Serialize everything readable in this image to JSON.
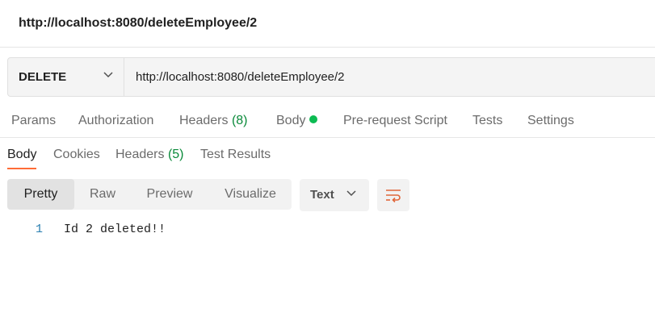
{
  "title": "http://localhost:8080/deleteEmployee/2",
  "request": {
    "method": "DELETE",
    "url": "http://localhost:8080/deleteEmployee/2"
  },
  "request_tabs": {
    "params": "Params",
    "authorization": "Authorization",
    "headers_label": "Headers",
    "headers_count": "(8)",
    "body": "Body",
    "prerequest": "Pre-request Script",
    "tests": "Tests",
    "settings": "Settings"
  },
  "response_tabs": {
    "body": "Body",
    "cookies": "Cookies",
    "headers_label": "Headers",
    "headers_count": "(5)",
    "test_results": "Test Results"
  },
  "view_modes": {
    "pretty": "Pretty",
    "raw": "Raw",
    "preview": "Preview",
    "visualize": "Visualize"
  },
  "format": {
    "selected": "Text"
  },
  "icons": {
    "method_dropdown": "chevron-down-icon",
    "body_status": "green-dot-icon",
    "format_dropdown": "chevron-down-icon",
    "wrap": "text-wrap-icon"
  },
  "colors": {
    "accent": "#ff6c37",
    "status_green": "#0cbb52",
    "count_green": "#0a8a3a",
    "line_number": "#2a7fb0"
  },
  "response_body": [
    {
      "line": "1",
      "text": "Id 2 deleted!!"
    }
  ]
}
